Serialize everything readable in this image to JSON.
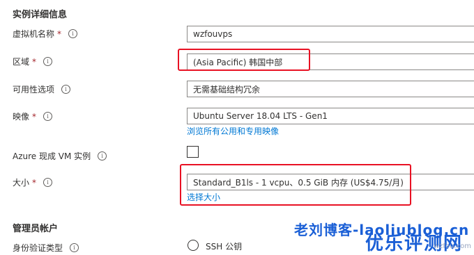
{
  "instance_details": {
    "section_title": "实例详细信息",
    "vm_name": {
      "label": "虚拟机名称",
      "required_mark": "*",
      "value": "wzfouvps"
    },
    "region": {
      "label": "区域",
      "required_mark": "*",
      "value": "(Asia Pacific) 韩国中部"
    },
    "availability": {
      "label": "可用性选项",
      "value": "无需基础结构冗余"
    },
    "image": {
      "label": "映像",
      "required_mark": "*",
      "value": "Ubuntu Server 18.04 LTS - Gen1",
      "link": "浏览所有公用和专用映像"
    },
    "spot": {
      "label": "Azure 现成 VM 实例"
    },
    "size": {
      "label": "大小",
      "required_mark": "*",
      "value": "Standard_B1ls - 1 vcpu、0.5 GiB 内存 (US$4.75/月)",
      "link": "选择大小"
    }
  },
  "admin_account": {
    "section_title": "管理员帐户",
    "auth_type": {
      "label": "身份验证类型",
      "option_ssh": "SSH 公钥"
    }
  },
  "info_icon_glyph": "i",
  "watermark": {
    "line1": "老刘博客-laoliublog.cn",
    "line2": "优乐评测网",
    "line3": "wzfou.com"
  },
  "colors": {
    "accent": "#0078d4",
    "highlight": "#e81123",
    "required": "#a4262c",
    "watermark": "#1a5fd6"
  }
}
